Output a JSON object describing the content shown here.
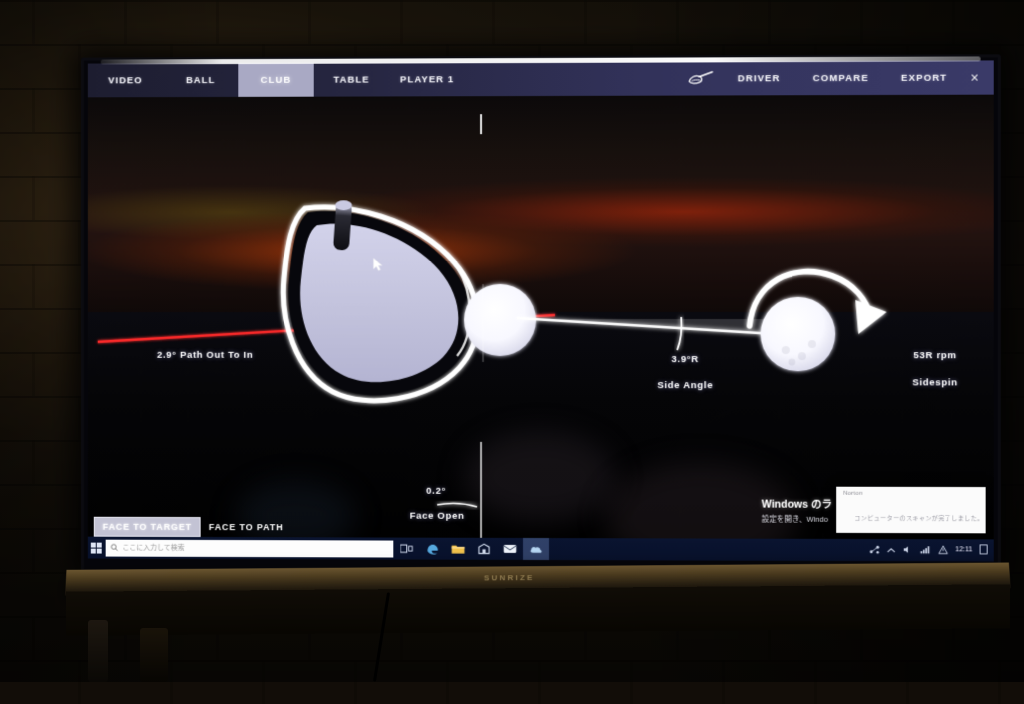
{
  "room": {
    "tv_brand": "SUNRIZE"
  },
  "app": {
    "nav_left": [
      {
        "label": "VIDEO",
        "active": false
      },
      {
        "label": "BALL",
        "active": false
      },
      {
        "label": "CLUB",
        "active": true
      },
      {
        "label": "TABLE",
        "active": false
      },
      {
        "label": "PLAYER 1",
        "active": false
      }
    ],
    "club_icon": "golf-driver-icon",
    "nav_right": [
      {
        "label": "DRIVER"
      },
      {
        "label": "COMPARE"
      },
      {
        "label": "EXPORT"
      }
    ],
    "close_label": "×",
    "bottom_tabs": [
      {
        "label": "FACE TO TARGET",
        "active": true
      },
      {
        "label": "FACE TO PATH",
        "active": false
      }
    ],
    "measurements": [
      {
        "id": "club-path",
        "value": "2.9°",
        "name": "Path Out To In",
        "display": "2.9° Path Out To In"
      },
      {
        "id": "side-angle",
        "value": "3.9°R",
        "name": "Side Angle"
      },
      {
        "id": "sidespin",
        "value": "53R rpm",
        "name": "Sidespin"
      },
      {
        "id": "face-angle",
        "value": "0.2°",
        "name": "Face Open"
      }
    ],
    "colors": {
      "path_line": "#ff2a2a",
      "target_line": "#ffffff",
      "nav_gradient_start": "#1d1d30",
      "nav_gradient_end": "#3a3a68",
      "active_tab_bg": "#a9a9c4",
      "club_face": "#c6c6e0",
      "ball": "#ffffff"
    }
  },
  "windows": {
    "toast_title": "Windows のラ",
    "toast_body": "設定を開き、Windo",
    "norton_logo": "Norton",
    "norton_message": "コンピューターのスキャンが完了しました。",
    "search_placeholder": "ここに入力して検索",
    "clock": "12:11",
    "taskbar_icons": [
      "task-view-icon",
      "edge-icon",
      "file-explorer-icon",
      "store-icon",
      "mail-icon",
      "weather-icon"
    ],
    "tray_icons": [
      "network-icon",
      "chevron-up-icon",
      "volume-icon",
      "wifi-icon",
      "warning-icon"
    ]
  }
}
